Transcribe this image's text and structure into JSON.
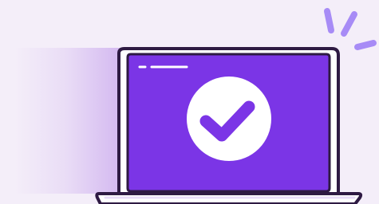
{
  "illustration": {
    "subject": "laptop-with-checkmark",
    "screen_state": "success",
    "icons": {
      "status": "checkmark-icon",
      "accent": "spark-lines-icon"
    },
    "colors": {
      "background": "#f4eef9",
      "light_beam": "#d8c1ef",
      "screen": "#7b35e6",
      "outline": "#2e1a43",
      "window_lines": "#ffffff",
      "check_circle": "#ffffff",
      "checkmark": "#7b35e6",
      "spark_lines": "#a78bf6",
      "base_top": "#ffffff",
      "base_shadow": "#e8dcf8"
    }
  }
}
